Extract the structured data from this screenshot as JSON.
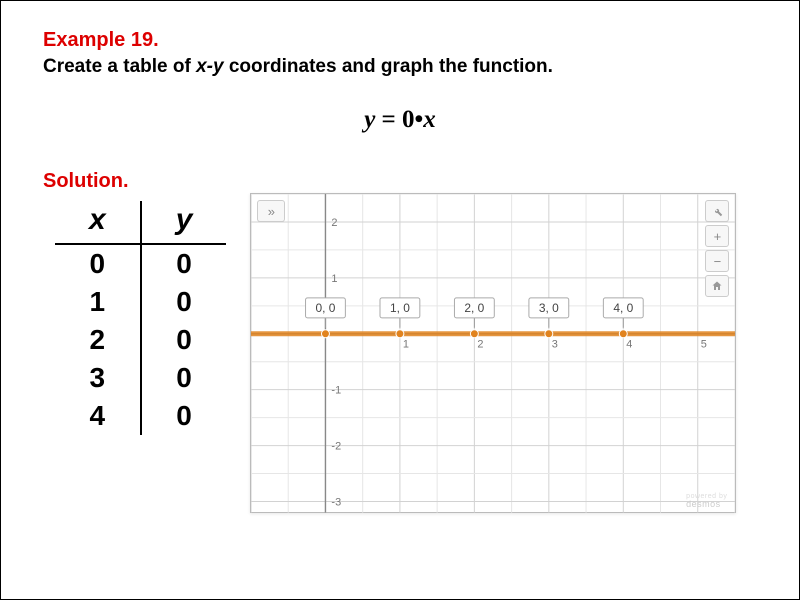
{
  "example_label": "Example 19.",
  "instruction_prefix": "Create a table of ",
  "instruction_xy": "x-y",
  "instruction_suffix": " coordinates and graph the function.",
  "equation": {
    "lhs": "y",
    "eq": " = 0•",
    "rhs": "x"
  },
  "solution_label": "Solution.",
  "table": {
    "headers": {
      "x": "x",
      "y": "y"
    },
    "rows": [
      {
        "x": "0",
        "y": "0"
      },
      {
        "x": "1",
        "y": "0"
      },
      {
        "x": "2",
        "y": "0"
      },
      {
        "x": "3",
        "y": "0"
      },
      {
        "x": "4",
        "y": "0"
      }
    ]
  },
  "graph": {
    "x_ticks": [
      1,
      2,
      3,
      4,
      5
    ],
    "y_ticks": [
      -3,
      -2,
      -1,
      1,
      2
    ],
    "points": [
      {
        "x": 0,
        "y": 0,
        "label": "0, 0"
      },
      {
        "x": 1,
        "y": 0,
        "label": "1, 0"
      },
      {
        "x": 2,
        "y": 0,
        "label": "2, 0"
      },
      {
        "x": 3,
        "y": 0,
        "label": "3, 0"
      },
      {
        "x": 4,
        "y": 0,
        "label": "4, 0"
      }
    ],
    "watermark_top": "powered by",
    "watermark": "desmos",
    "expand_glyph": "»",
    "zoom_in": "+",
    "zoom_out": "−"
  },
  "chart_data": {
    "type": "scatter",
    "title": "",
    "xlabel": "",
    "ylabel": "",
    "x": [
      0,
      1,
      2,
      3,
      4
    ],
    "y": [
      0,
      0,
      0,
      0,
      0
    ],
    "xlim": [
      -1,
      5.5
    ],
    "ylim": [
      -3.2,
      2.5
    ],
    "grid": true,
    "overlay_line": {
      "type": "horizontal",
      "y": 0,
      "color": "#e1831e"
    },
    "point_labels": [
      "0, 0",
      "1, 0",
      "2, 0",
      "3, 0",
      "4, 0"
    ]
  }
}
